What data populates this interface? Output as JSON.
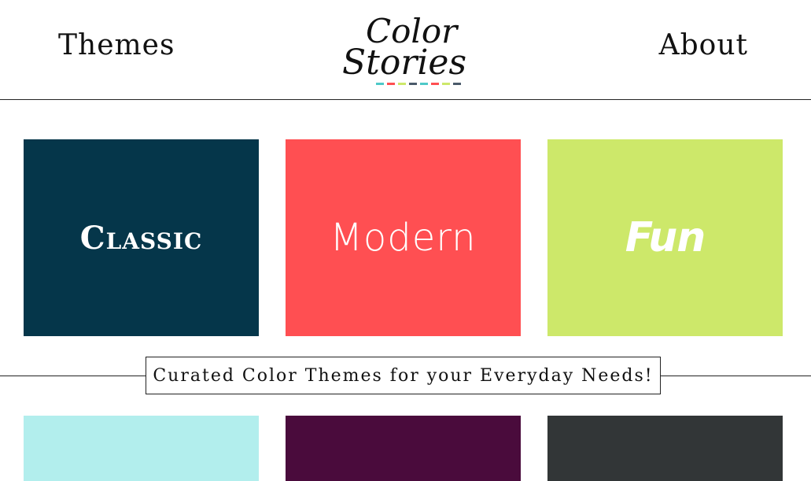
{
  "header": {
    "nav_left": "Themes",
    "nav_right": "About",
    "logo": {
      "line1": "Color",
      "line2": "Stories",
      "dash_colors": [
        "#4ec9c8",
        "#ff4f52",
        "#cde86a",
        "#4a5a6a",
        "#4ec9c8",
        "#ff4f52",
        "#cde86a",
        "#4a5a6a"
      ]
    }
  },
  "themes_row1": [
    {
      "label": "Classic",
      "color": "#05364a"
    },
    {
      "label": "Modern",
      "color": "#ff4f52"
    },
    {
      "label": "Fun",
      "color": "#cde86a"
    }
  ],
  "tagline": "Curated Color Themes for your Everyday Needs!",
  "themes_row2": [
    {
      "color": "#b2eeed"
    },
    {
      "color": "#4a0b3c"
    },
    {
      "color": "#323637"
    }
  ]
}
